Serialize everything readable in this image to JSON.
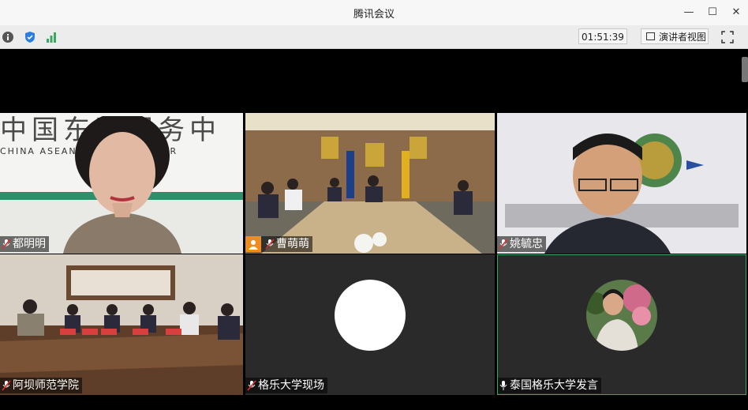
{
  "window": {
    "title": "腾讯会议"
  },
  "toolbar": {
    "timer": "01:51:39",
    "speaker_view_label": "演讲者视图"
  },
  "tiles": [
    {
      "name": "都明明",
      "muted": true,
      "banner_text": "中国东盟服务中",
      "banner_sub": "CHINA ASEAN SERVICE CENTER"
    },
    {
      "name": "曹萌萌",
      "muted": true,
      "has_avatar_badge": true
    },
    {
      "name": "姚毓忠",
      "muted": true
    },
    {
      "name": "阿坝师范学院",
      "muted": true
    },
    {
      "name": "格乐大学现场",
      "muted": true
    },
    {
      "name": "泰国格乐大学发言",
      "muted": false,
      "active_speaker": true
    }
  ],
  "colors": {
    "active_border": "#3aa860",
    "tile_bg": "#2a2a2a",
    "badge": "#f08c1e"
  }
}
